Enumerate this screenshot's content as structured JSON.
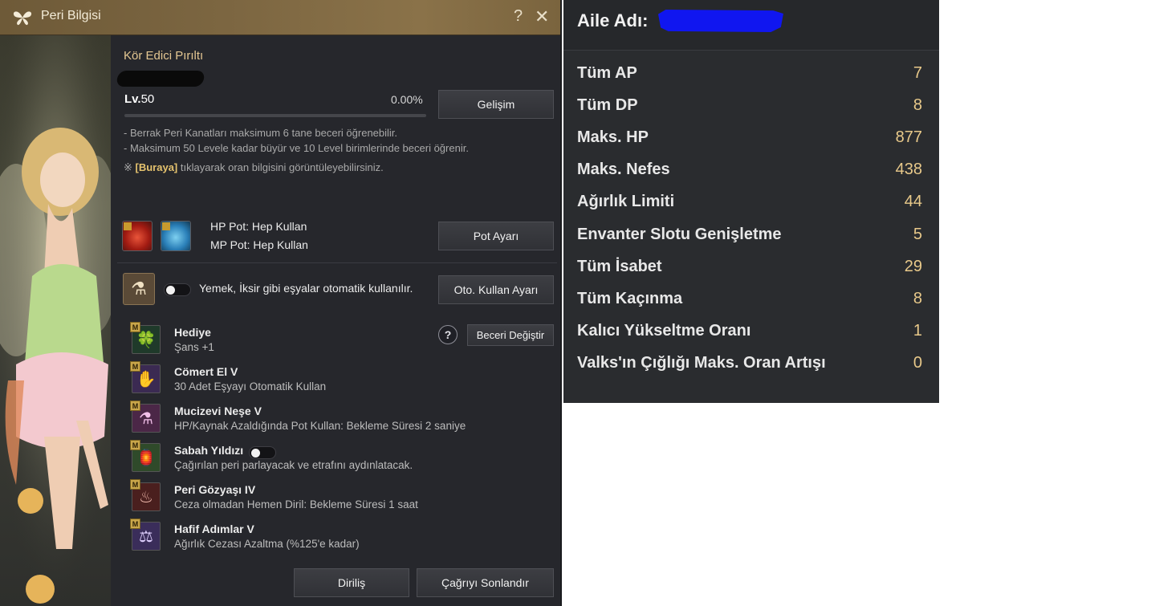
{
  "peri_window": {
    "title": "Peri Bilgisi",
    "help_glyph": "?",
    "close_glyph": "✕",
    "fairy_name": "Kör Edici Pırıltı",
    "level_prefix": "Lv.",
    "level": "50",
    "exp_percent": "0.00%",
    "exp_fraction": 0.0,
    "gelisim_button": "Gelişim",
    "info_lines": [
      "- Berrak Peri Kanatları maksimum 6 tane beceri öğrenebilir.",
      "- Maksimum 50 Levele kadar büyür ve 10 Level birimlerinde beceri öğrenir."
    ],
    "info_link_prefix": "※ ",
    "info_link": "[Buraya]",
    "info_link_suffix": " tıklayarak oran bilgisini görüntüleyebilirsiniz.",
    "hp_pot_text": "HP Pot: Hep Kullan",
    "mp_pot_text": "MP Pot: Hep Kullan",
    "pot_button": "Pot Ayarı",
    "auto_use_text": "Yemek, İksir gibi eşyalar otomatik kullanılır.",
    "auto_use_enabled": false,
    "oto_button": "Oto. Kullan Ayarı",
    "skill_help_glyph": "?",
    "beceri_button": "Beceri Değiştir",
    "skill_badge": "M",
    "skills": [
      {
        "name": "Hediye",
        "desc": "Şans +1",
        "icon": "clover-icon",
        "glyph": "🍀"
      },
      {
        "name": "Cömert El V",
        "desc": "30 Adet Eşyayı Otomatik Kullan",
        "icon": "fairy-hand-icon",
        "glyph": "✋"
      },
      {
        "name": "Mucizevi Neşe V",
        "desc": "HP/Kaynak Azaldığında Pot Kullan: Bekleme Süresi 2 saniye",
        "icon": "potion-icon",
        "glyph": "⚗"
      },
      {
        "name": "Sabah Yıldızı",
        "desc": "Çağırılan peri parlayacak ve etrafını aydınlatacak.",
        "icon": "lantern-icon",
        "glyph": "🏮",
        "toggle_enabled": false
      },
      {
        "name": "Peri Gözyaşı IV",
        "desc": "Ceza olmadan Hemen Diril: Bekleme Süresi 1 saat",
        "icon": "tear-icon",
        "glyph": "♨"
      },
      {
        "name": "Hafif Adımlar V",
        "desc": "Ağırlık Cezası Azaltma (%125'e kadar)",
        "icon": "weight-icon",
        "glyph": "⚖"
      }
    ],
    "dirilis_button": "Diriliş",
    "cagri_button": "Çağrıyı Sonlandır"
  },
  "stats_panel": {
    "family_label": "Aile Adı:",
    "stats": [
      {
        "label": "Tüm AP",
        "value": "7"
      },
      {
        "label": "Tüm DP",
        "value": "8"
      },
      {
        "label": "Maks. HP",
        "value": "877"
      },
      {
        "label": "Maks. Nefes",
        "value": "438"
      },
      {
        "label": "Ağırlık Limiti",
        "value": "44"
      },
      {
        "label": "Envanter Slotu Genişletme",
        "value": "5"
      },
      {
        "label": "Tüm İsabet",
        "value": "29"
      },
      {
        "label": "Tüm Kaçınma",
        "value": "8"
      },
      {
        "label": "Kalıcı Yükseltme Oranı",
        "value": "1"
      },
      {
        "label": "Valks'ın Çığlığı Maks. Oran Artışı",
        "value": "0"
      }
    ]
  },
  "colors": {
    "titlebar": "#7c6641",
    "accent_gold": "#e4c792",
    "link": "#e4c26e",
    "stat_value": "#e8c98a",
    "redaction_blue": "#1016f0"
  }
}
